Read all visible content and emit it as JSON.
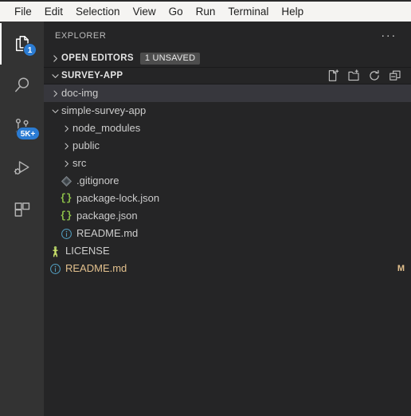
{
  "window": {
    "menu": [
      "File",
      "Edit",
      "Selection",
      "View",
      "Go",
      "Run",
      "Terminal",
      "Help"
    ]
  },
  "activity_bar": {
    "items": [
      {
        "name": "explorer",
        "icon": "files-icon",
        "title": "Explorer",
        "badge": "1",
        "badge_style": "circle",
        "active": true
      },
      {
        "name": "search",
        "icon": "search-icon",
        "title": "Search",
        "badge": "",
        "badge_style": "none",
        "active": false
      },
      {
        "name": "source-control",
        "icon": "source-control-icon",
        "title": "Source Control",
        "badge": "5K+",
        "badge_style": "pill",
        "active": false
      },
      {
        "name": "run-debug",
        "icon": "run-and-debug-icon",
        "title": "Run and Debug",
        "badge": "",
        "badge_style": "none",
        "active": false
      },
      {
        "name": "extensions",
        "icon": "extensions-icon",
        "title": "Extensions",
        "badge": "",
        "badge_style": "none",
        "active": false
      }
    ]
  },
  "sidebar": {
    "title": "EXPLORER",
    "more_actions": "···",
    "open_editors": {
      "label": "OPEN EDITORS",
      "badge": "1 UNSAVED",
      "expanded": false
    },
    "folder": {
      "label": "SURVEY-APP",
      "expanded": true,
      "actions": [
        {
          "name": "new-file-icon",
          "title": "New File"
        },
        {
          "name": "new-folder-icon",
          "title": "New Folder"
        },
        {
          "name": "refresh-icon",
          "title": "Refresh Explorer"
        },
        {
          "name": "collapse-all-icon",
          "title": "Collapse Folders in Explorer"
        }
      ]
    },
    "tree": [
      {
        "label": "doc-img",
        "type": "folder",
        "indent": 1,
        "expanded": false,
        "selected": true,
        "icon": "chevron-right-icon",
        "modified": false,
        "git": ""
      },
      {
        "label": "simple-survey-app",
        "type": "folder",
        "indent": 1,
        "expanded": true,
        "selected": false,
        "icon": "chevron-down-icon",
        "modified": false,
        "git": ""
      },
      {
        "label": "node_modules",
        "type": "folder",
        "indent": 2,
        "expanded": false,
        "selected": false,
        "icon": "chevron-right-icon",
        "modified": false,
        "git": ""
      },
      {
        "label": "public",
        "type": "folder",
        "indent": 2,
        "expanded": false,
        "selected": false,
        "icon": "chevron-right-icon",
        "modified": false,
        "git": ""
      },
      {
        "label": "src",
        "type": "folder",
        "indent": 2,
        "expanded": false,
        "selected": false,
        "icon": "chevron-right-icon",
        "modified": false,
        "git": ""
      },
      {
        "label": ".gitignore",
        "type": "file",
        "indent": 2,
        "expanded": false,
        "selected": false,
        "icon": "git-file-icon",
        "modified": false,
        "git": ""
      },
      {
        "label": "package-lock.json",
        "type": "file",
        "indent": 2,
        "expanded": false,
        "selected": false,
        "icon": "json-file-icon",
        "modified": false,
        "git": ""
      },
      {
        "label": "package.json",
        "type": "file",
        "indent": 2,
        "expanded": false,
        "selected": false,
        "icon": "json-file-icon",
        "modified": false,
        "git": ""
      },
      {
        "label": "README.md",
        "type": "file",
        "indent": 2,
        "expanded": false,
        "selected": false,
        "icon": "markdown-file-icon",
        "modified": false,
        "git": ""
      },
      {
        "label": "LICENSE",
        "type": "file",
        "indent": 1,
        "expanded": false,
        "selected": false,
        "icon": "license-file-icon",
        "modified": false,
        "git": ""
      },
      {
        "label": "README.md",
        "type": "file",
        "indent": 1,
        "expanded": false,
        "selected": false,
        "icon": "markdown-file-icon",
        "modified": true,
        "git": "M"
      }
    ]
  },
  "colors": {
    "titlebar_bg": "#f5f4f2",
    "activitybar_bg": "#333333",
    "sidebar_bg": "#252526",
    "editor_bg": "#1e1e1e",
    "badge_bg": "#2b7cd3",
    "selection_bg": "#37373d",
    "modified_fg": "#e2c08d",
    "json_icon": "#8dc149",
    "md_icon": "#519aba",
    "license_icon": "#a5c261"
  }
}
